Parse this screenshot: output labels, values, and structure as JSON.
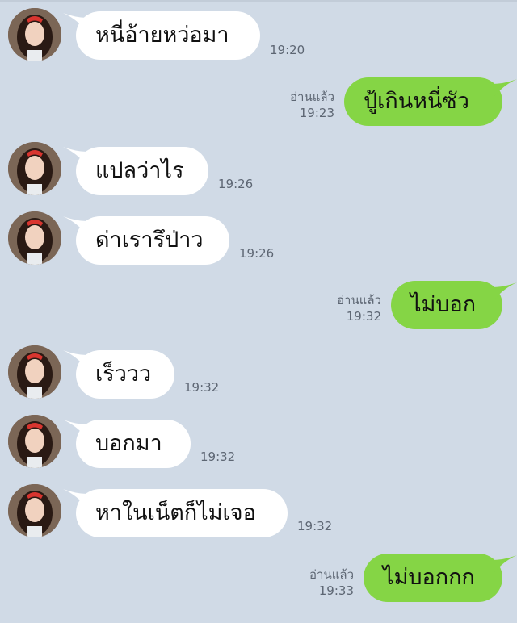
{
  "chat": {
    "messages": [
      {
        "side": "in",
        "text": "หนี่อ้ายหว่อมา",
        "time": "19:20"
      },
      {
        "side": "out",
        "text": "ปู้เกินหนี่ซัว",
        "time": "19:23",
        "read": "อ่านแล้ว"
      },
      {
        "side": "in",
        "text": "แปลว่าไร",
        "time": "19:26"
      },
      {
        "side": "in",
        "text": "ด่าเรารึป่าว",
        "time": "19:26"
      },
      {
        "side": "out",
        "text": "ไม่บอก",
        "time": "19:32",
        "read": "อ่านแล้ว"
      },
      {
        "side": "in",
        "text": "เร็ววว",
        "time": "19:32"
      },
      {
        "side": "in",
        "text": "บอกมา",
        "time": "19:32"
      },
      {
        "side": "in",
        "text": "หาในเน็ตก็ไม่เจอ",
        "time": "19:32"
      },
      {
        "side": "out",
        "text": "ไม่บอกกก",
        "time": "19:33",
        "read": "อ่านแล้ว"
      }
    ]
  },
  "colors": {
    "background": "#d0dae6",
    "incoming_bubble": "#ffffff",
    "outgoing_bubble": "#85d545",
    "meta_text": "#5d6673"
  }
}
